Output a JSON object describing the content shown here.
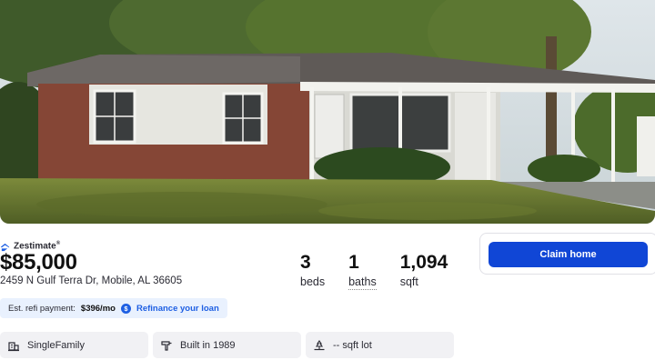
{
  "listing": {
    "zestimate_label": "Zestimate",
    "zestimate_mark": "®",
    "price": "$85,000",
    "address": "2459 N Gulf Terra Dr, Mobile, AL 36605"
  },
  "stats": [
    {
      "value": "3",
      "label": "beds"
    },
    {
      "value": "1",
      "label": "baths"
    },
    {
      "value": "1,094",
      "label": "sqft"
    }
  ],
  "refi": {
    "prefix": "Est. refi payment:",
    "amount": "$396/mo",
    "dollar_glyph": "$",
    "link": "Refinance your loan"
  },
  "facts": [
    {
      "icon": "building-icon",
      "text": "SingleFamily"
    },
    {
      "icon": "hammer-icon",
      "text": "Built in 1989"
    },
    {
      "icon": "lot-icon",
      "text": "-- sqft lot"
    }
  ],
  "claim": {
    "button_label": "Claim home"
  },
  "colors": {
    "accent": "#1046d6",
    "refi_bg": "#e9f1fe",
    "fact_bg": "#f1f1f4"
  }
}
